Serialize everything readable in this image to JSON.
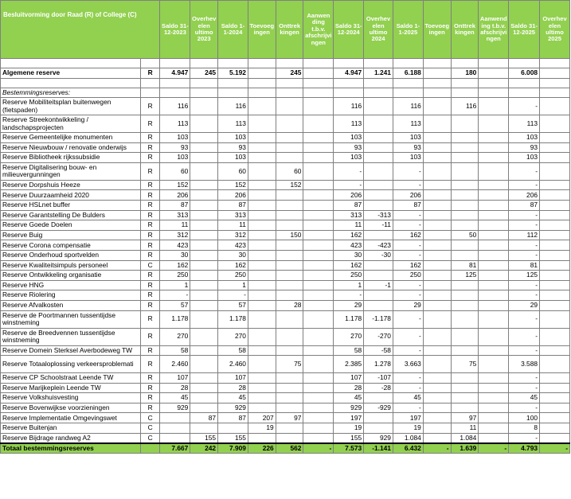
{
  "header": {
    "col1": "Besluitvorming door Raad (R) of College (C)",
    "columns": [
      "Saldo 31-12-2023",
      "Overhev elen ultimo 2023",
      "Saldo 1-1-2024",
      "Toevoeg ingen",
      "Onttrek kingen",
      "Aanwen ding t.b.v. afschrijvi ngen",
      "Saldo 31-12-2024",
      "Overhev elen ultimo 2024",
      "Saldo 1-1-2025",
      "Toevoeg ingen",
      "Onttrek kingen",
      "Aanwend ing t.b.v. afschrijvi ngen",
      "Saldo 31-12-2025",
      "Overhev elen ultimo 2025"
    ]
  },
  "algemene_reserve": {
    "name": "Algemene reserve",
    "kind": "R",
    "values": [
      "4.947",
      "245",
      "5.192",
      "",
      "245",
      "",
      "4.947",
      "1.241",
      "6.188",
      "",
      "180",
      "",
      "6.008",
      ""
    ]
  },
  "section_label": "Bestemmingsreserves:",
  "rows": [
    {
      "name": "Reserve Mobiliteitsplan buitenwegen (fietspaden)",
      "kind": "R",
      "values": [
        "116",
        "",
        "116",
        "",
        "",
        "",
        "116",
        "",
        "116",
        "",
        "116",
        "",
        "-",
        ""
      ]
    },
    {
      "name": "Reserve Streekontwikkeling / landschapsprojecten",
      "kind": "R",
      "values": [
        "113",
        "",
        "113",
        "",
        "",
        "",
        "113",
        "",
        "113",
        "",
        "",
        "",
        "113",
        ""
      ]
    },
    {
      "name": "Reserve Gemeentelijke monumenten",
      "kind": "R",
      "values": [
        "103",
        "",
        "103",
        "",
        "",
        "",
        "103",
        "",
        "103",
        "",
        "",
        "",
        "103",
        ""
      ]
    },
    {
      "name": "Reserve Nieuwbouw / renovatie onderwijs",
      "kind": "R",
      "values": [
        "93",
        "",
        "93",
        "",
        "",
        "",
        "93",
        "",
        "93",
        "",
        "",
        "",
        "93",
        ""
      ]
    },
    {
      "name": "Reserve Bibliotheek rijkssubsidie",
      "kind": "R",
      "values": [
        "103",
        "",
        "103",
        "",
        "",
        "",
        "103",
        "",
        "103",
        "",
        "",
        "",
        "103",
        ""
      ]
    },
    {
      "name": "Reserve Digitalisering bouw- en milieuvergunningen",
      "kind": "R",
      "values": [
        "60",
        "",
        "60",
        "",
        "60",
        "",
        "-",
        "",
        "-",
        "",
        "",
        "",
        "-",
        ""
      ]
    },
    {
      "name": "Reserve Dorpshuis Heeze",
      "kind": "R",
      "values": [
        "152",
        "",
        "152",
        "",
        "152",
        "",
        "-",
        "",
        "-",
        "",
        "",
        "",
        "-",
        ""
      ]
    },
    {
      "name": "Reserve Duurzaamheid 2020",
      "kind": "R",
      "values": [
        "206",
        "",
        "206",
        "",
        "",
        "",
        "206",
        "",
        "206",
        "",
        "",
        "",
        "206",
        ""
      ]
    },
    {
      "name": "Reserve HSLnet buffer",
      "kind": "R",
      "values": [
        "87",
        "",
        "87",
        "",
        "",
        "",
        "87",
        "",
        "87",
        "",
        "",
        "",
        "87",
        ""
      ]
    },
    {
      "name": "Reserve Garantstelling De Bulders",
      "kind": "R",
      "values": [
        "313",
        "",
        "313",
        "",
        "",
        "",
        "313",
        "-313",
        "-",
        "",
        "",
        "",
        "-",
        ""
      ]
    },
    {
      "name": "Reserve Goede Doelen",
      "kind": "R",
      "values": [
        "11",
        "",
        "11",
        "",
        "",
        "",
        "11",
        "-11",
        "-",
        "",
        "",
        "",
        "-",
        ""
      ]
    },
    {
      "name": "Reserve Buig",
      "kind": "R",
      "values": [
        "312",
        "",
        "312",
        "",
        "150",
        "",
        "162",
        "",
        "162",
        "",
        "50",
        "",
        "112",
        ""
      ]
    },
    {
      "name": "Reserve Corona compensatie",
      "kind": "R",
      "values": [
        "423",
        "",
        "423",
        "",
        "",
        "",
        "423",
        "-423",
        "-",
        "",
        "",
        "",
        "-",
        ""
      ]
    },
    {
      "name": "Reserve Onderhoud sportvelden",
      "kind": "R",
      "values": [
        "30",
        "",
        "30",
        "",
        "",
        "",
        "30",
        "-30",
        "-",
        "",
        "",
        "",
        "-",
        ""
      ]
    },
    {
      "name": "Reserve Kwaliteitsimpuls personeel",
      "kind": "C",
      "values": [
        "162",
        "",
        "162",
        "",
        "",
        "",
        "162",
        "",
        "162",
        "",
        "81",
        "",
        "81",
        ""
      ]
    },
    {
      "name": "Reserve Ontwikkeling organisatie",
      "kind": "R",
      "values": [
        "250",
        "",
        "250",
        "",
        "",
        "",
        "250",
        "",
        "250",
        "",
        "125",
        "",
        "125",
        ""
      ]
    },
    {
      "name": "Reserve HNG",
      "kind": "R",
      "values": [
        "1",
        "",
        "1",
        "",
        "",
        "",
        "1",
        "-1",
        "-",
        "",
        "",
        "",
        "-",
        ""
      ]
    },
    {
      "name": "Reserve Riolering",
      "kind": "R",
      "values": [
        "-",
        "",
        "-",
        "",
        "",
        "",
        "-",
        "",
        "-",
        "",
        "",
        "",
        "-",
        ""
      ]
    },
    {
      "name": "Reserve Afvalkosten",
      "kind": "R",
      "values": [
        "57",
        "",
        "57",
        "",
        "28",
        "",
        "29",
        "",
        "29",
        "",
        "",
        "",
        "29",
        ""
      ]
    },
    {
      "name": "Reserve de Poortmannen tussentijdse winstneming",
      "kind": "R",
      "values": [
        "1.178",
        "",
        "1.178",
        "",
        "",
        "",
        "1.178",
        "-1.178",
        "-",
        "",
        "",
        "",
        "-",
        ""
      ]
    },
    {
      "name": "Reserve de Breedvennen tussentijdse winstneming",
      "kind": "R",
      "values": [
        "270",
        "",
        "270",
        "",
        "",
        "",
        "270",
        "-270",
        "-",
        "",
        "",
        "",
        "-",
        ""
      ]
    },
    {
      "name": "Reserve Domein Sterksel Averbodeweg TW",
      "kind": "R",
      "values": [
        "58",
        "",
        "58",
        "",
        "",
        "",
        "58",
        "-58",
        "-",
        "",
        "",
        "",
        "-",
        ""
      ]
    },
    {
      "name": "Reserve Totaaloplossing verkeersproblemati",
      "kind": "R",
      "values": [
        "2.460",
        "",
        "2.460",
        "",
        "75",
        "",
        "2.385",
        "1.278",
        "3.663",
        "",
        "75",
        "",
        "3.588",
        ""
      ]
    },
    {
      "name": "Reserve CP Schoolstraat Leende TW",
      "kind": "R",
      "values": [
        "107",
        "",
        "107",
        "",
        "",
        "",
        "107",
        "-107",
        "-",
        "",
        "",
        "",
        "-",
        ""
      ]
    },
    {
      "name": "Reserve Marijkeplein Leende TW",
      "kind": "R",
      "values": [
        "28",
        "",
        "28",
        "",
        "",
        "",
        "28",
        "-28",
        "-",
        "",
        "",
        "",
        "-",
        ""
      ]
    },
    {
      "name": "Reserve Volkshuisvesting",
      "kind": "R",
      "values": [
        "45",
        "",
        "45",
        "",
        "",
        "",
        "45",
        "",
        "45",
        "",
        "",
        "",
        "45",
        ""
      ]
    },
    {
      "name": "Reserve Bovenwijkse voorzieningen",
      "kind": "R",
      "values": [
        "929",
        "",
        "929",
        "",
        "",
        "",
        "929",
        "-929",
        "-",
        "",
        "",
        "",
        "-",
        ""
      ]
    },
    {
      "name": "Reserve Implementatie Omgevingswet",
      "kind": "C",
      "values": [
        "",
        "87",
        "87",
        "207",
        "97",
        "",
        "197",
        "",
        "197",
        "",
        "97",
        "",
        "100",
        ""
      ]
    },
    {
      "name": "Reserve Buitenjan",
      "kind": "C",
      "values": [
        "",
        "",
        "",
        "19",
        "",
        "",
        "19",
        "",
        "19",
        "",
        "11",
        "",
        "8",
        ""
      ]
    },
    {
      "name": "Reserve Bijdrage randweg A2",
      "kind": "C",
      "values": [
        "",
        "155",
        "155",
        "",
        "",
        "",
        "155",
        "929",
        "1.084",
        "",
        "1.084",
        "",
        "-",
        ""
      ]
    }
  ],
  "total": {
    "name": "Totaal bestemmingsreserves",
    "values": [
      "7.667",
      "242",
      "7.909",
      "226",
      "562",
      "-",
      "7.573",
      "-1.141",
      "6.432",
      "-",
      "1.639",
      "-",
      "4.793",
      "-"
    ]
  }
}
